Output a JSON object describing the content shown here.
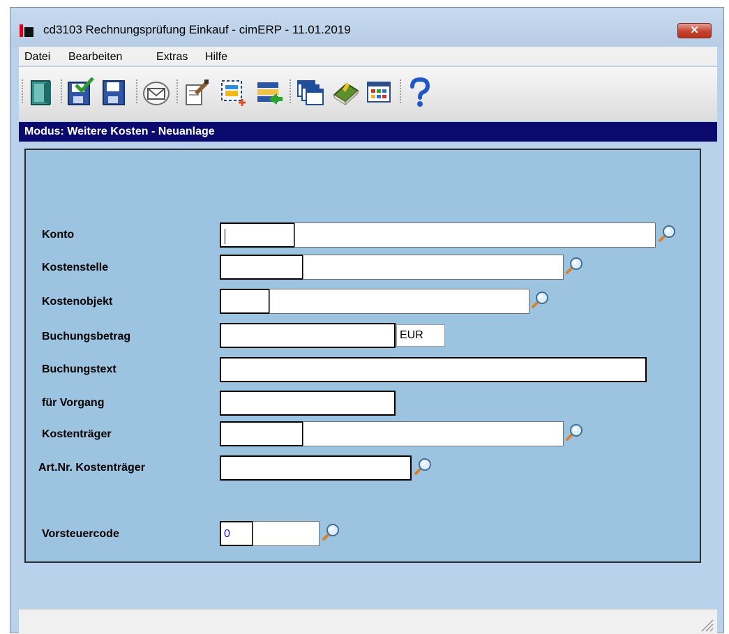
{
  "window": {
    "title": "cd3103 Rechnungsprüfung Einkauf - cimERP - 11.01.2019",
    "close_label": "✕"
  },
  "menu": {
    "items": [
      "Datei",
      "Bearbeiten",
      "Extras",
      "Hilfe"
    ]
  },
  "toolbar": {
    "buttons": [
      {
        "icon": "exit-door-icon"
      },
      {
        "icon": "save-check-icon"
      },
      {
        "icon": "save-icon"
      },
      {
        "icon": "envelope-icon"
      },
      {
        "icon": "edit-document-icon"
      },
      {
        "icon": "new-selection-icon"
      },
      {
        "icon": "list-transfer-icon"
      },
      {
        "icon": "windows-icon"
      },
      {
        "icon": "book-icon"
      },
      {
        "icon": "table-icon"
      },
      {
        "icon": "help-icon"
      }
    ]
  },
  "mode": {
    "text": "Modus: Weitere Kosten - Neuanlage"
  },
  "form": {
    "konto": {
      "label": "Konto",
      "code": "",
      "text": ""
    },
    "kostenstelle": {
      "label": "Kostenstelle",
      "code": "",
      "text": ""
    },
    "kostenobjekt": {
      "label": "Kostenobjekt",
      "code": "",
      "text": ""
    },
    "buchungsbetrag": {
      "label": "Buchungsbetrag",
      "value": "",
      "currency": "EUR"
    },
    "buchungstext": {
      "label": "Buchungstext",
      "value": ""
    },
    "vorgang": {
      "label": "für Vorgang",
      "value": ""
    },
    "kostentraeger": {
      "label": "Kostenträger",
      "code": "",
      "text": ""
    },
    "artnr": {
      "label": "Art.Nr. Kostenträger",
      "value": ""
    },
    "vorsteuercode": {
      "label": "Vorsteuercode",
      "code": "0",
      "text": ""
    }
  },
  "colors": {
    "mode_bar": "#0a0a6e",
    "panel": "#9cc3df",
    "window_bg": "#b9d1ea",
    "vorsteuer_code_text": "#1a1acc"
  }
}
